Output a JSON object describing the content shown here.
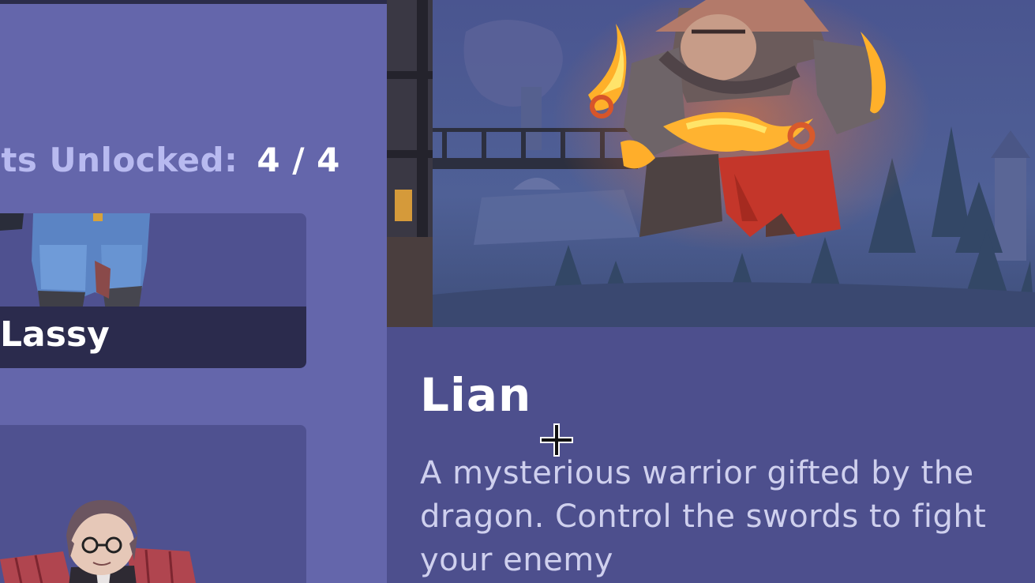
{
  "roster": {
    "slots_label": "ots Unlocked:",
    "slots_value": "4 / 4",
    "cards": [
      {
        "name": "Lassy"
      },
      {
        "name": ""
      }
    ]
  },
  "detail": {
    "name": "Lian",
    "description": "A mysterious warrior gifted by the dragon. Control the swords to fight your enemy"
  },
  "colors": {
    "left_panel": "#6466ab",
    "right_panel": "#4d4f8d",
    "card": "#4f5190",
    "name_bar": "#2b2b4d"
  },
  "icons": {
    "cursor": "crosshair-cursor-icon"
  }
}
